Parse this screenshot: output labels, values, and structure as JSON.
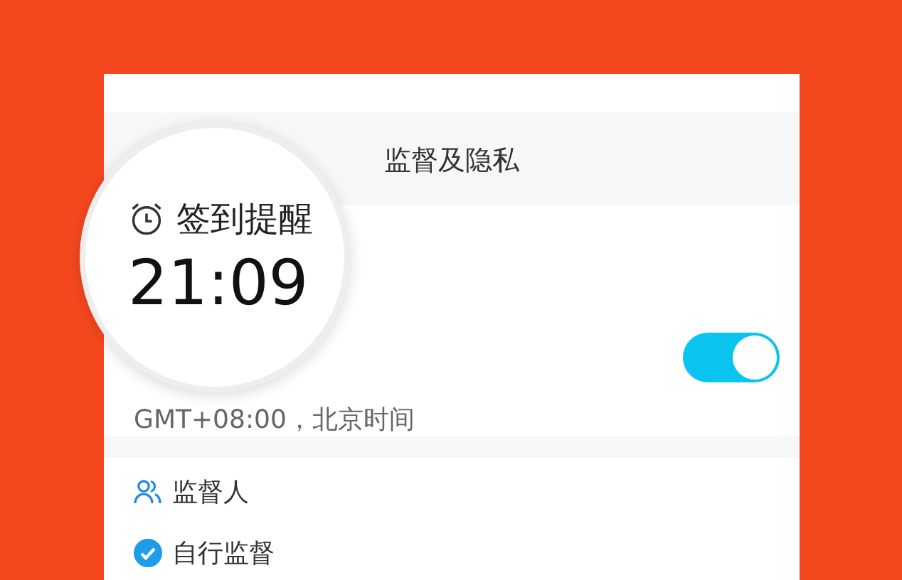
{
  "screen": {
    "title": "监督及隐私"
  },
  "reminder": {
    "label": "签到提醒",
    "time": "21:09",
    "on": true,
    "timezone": "GMT+08:00，北京时间"
  },
  "options": [
    {
      "kind": "people",
      "label": "监督人"
    },
    {
      "kind": "check",
      "label": "自行监督",
      "checked": true
    }
  ]
}
